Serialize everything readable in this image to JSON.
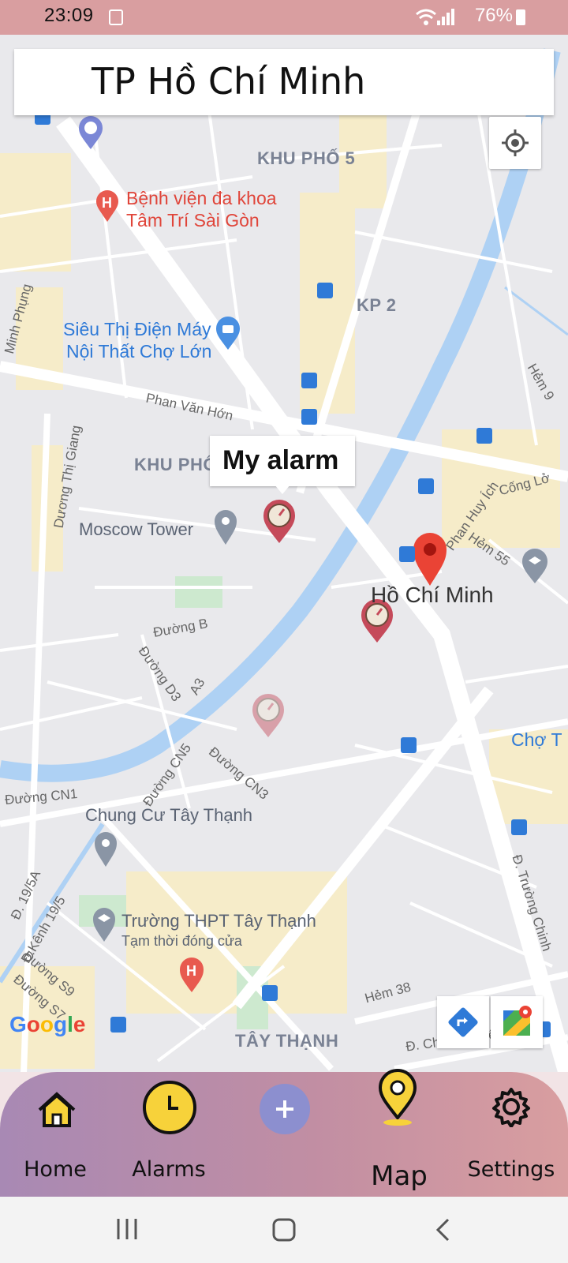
{
  "status_bar": {
    "time": "23:09",
    "battery": "76%"
  },
  "search": {
    "text": "TP Hồ Chí Minh"
  },
  "map": {
    "labels": {
      "khu_pho_5": "KHU PHỐ 5",
      "kp2": "KP 2",
      "khu_pho_partial": "KHU PHỐ",
      "tay_thanh": "TÂY THẠNH",
      "hospital_line1": "Bệnh viện đa khoa",
      "hospital_line2": "Tâm Trí Sài Gòn",
      "store_line1": "Siêu Thị Điện Máy",
      "store_line2": "Nội Thất Chợ Lớn",
      "moscow": "Moscow Tower",
      "ho_chi_minh": "Hồ Chí Minh",
      "chung_cu": "Chung Cư Tây Thạnh",
      "school_line1": "Trường THPT Tây Thạnh",
      "school_line2": "Tạm thời đóng cửa",
      "cho_partial": "Chợ T",
      "phan_van_hon": "Phan Văn Hớn",
      "duong_thi_giang": "Dương Thị Giang",
      "minh_phung": "Minh Phụng",
      "phan_huy_ich": "Phan Huy Ích",
      "hem_55": "Hẻm 55",
      "hem_9": "Hẻm 9",
      "cong_lo": "Cống Lở",
      "duong_b": "Đường B",
      "duong_d3": "Đường D3",
      "a3": "A3",
      "duong_cn5": "Đường CN5",
      "duong_cn3": "Đường CN3",
      "duong_cn1": "Đường CN1",
      "d_19_5a": "Đ. 19/5A",
      "d_kenh_19_5": "Đ.Kênh 19/5",
      "duong_s9": "Đường S9",
      "duong_s7": "Đường S7",
      "hem_38": "Hẻm 38",
      "d_che_lan_vien": "Đ. Chế Lan Viên",
      "d_truong_chinh": "Đ. Trường Chinh",
      "google": "Google"
    },
    "bubble": "My alarm"
  },
  "nav": {
    "home": "Home",
    "alarms": "Alarms",
    "map": "Map",
    "settings": "Settings",
    "accent": "#f7d23a"
  },
  "colors": {
    "status_bar": "#d99ea0",
    "nav_start": "#a889b4",
    "nav_end": "#d99ea0",
    "add_button": "#8c8fcf"
  }
}
